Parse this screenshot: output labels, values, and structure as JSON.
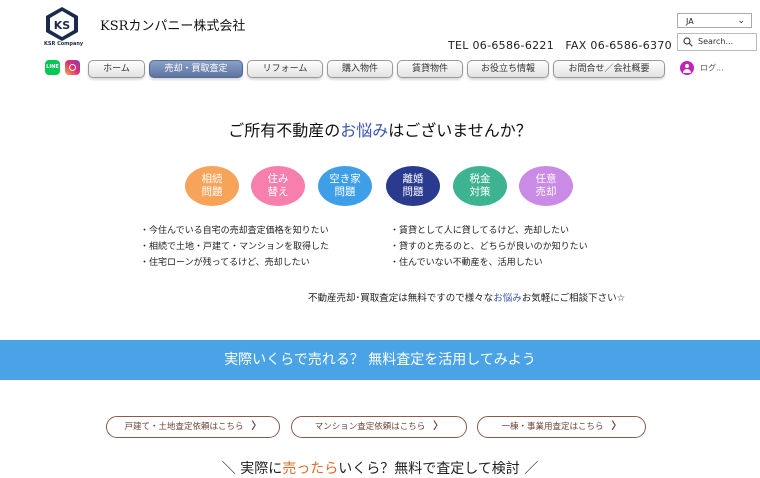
{
  "header": {
    "logo_text": "KSR Company",
    "company_name": "KSRカンパニー株式会社",
    "language": "JA",
    "phone_line": "TEL 06-6586-6221　FAX 06-6586-6370",
    "search_placeholder": "Search...",
    "login_label": "ログ..."
  },
  "nav": {
    "items": [
      {
        "label": "ホーム"
      },
      {
        "label": "売却・買取査定"
      },
      {
        "label": "リフォーム"
      },
      {
        "label": "購入物件"
      },
      {
        "label": "賃貸物件"
      },
      {
        "label": "お役立ち情報"
      },
      {
        "label": "お問合せ／会社概要"
      }
    ],
    "active": "売却・買取査定"
  },
  "headline": {
    "before": "ご所有不動産の",
    "highlight": "お悩み",
    "after": "はございませんか？"
  },
  "categories": [
    {
      "line1": "相続",
      "line2": "問題",
      "color": "#f7a35a"
    },
    {
      "line1": "住み",
      "line2": "替え",
      "color": "#f77fae"
    },
    {
      "line1": "空き家",
      "line2": "問題",
      "color": "#3f9ee8"
    },
    {
      "line1": "離婚",
      "line2": "問題",
      "color": "#2a3b8f"
    },
    {
      "line1": "税金",
      "line2": "対策",
      "color": "#3eb391"
    },
    {
      "line1": "任意",
      "line2": "売却",
      "color": "#c98be6"
    }
  ],
  "concerns_left": [
    "今住んでいる自宅の売却査定価格を知りたい",
    "相続で土地・戸建て・マンションを取得した",
    "住宅ローンが残ってるけど、売却したい"
  ],
  "concerns_right": [
    "賃貸として人に貸してるけど、売却したい",
    "貸すのと売るのと、どちらが良いのか知りたい",
    "住んでいない不動産を、活用したい"
  ],
  "note": {
    "before": "不動産売却･買取査定は無料ですので様々な",
    "highlight": "お悩み",
    "after": "お気軽にご相談下さい☆"
  },
  "banner_text": "実際いくらで売れる？ 無料査定を活用してみよう",
  "cta_buttons": [
    {
      "label": "戸建て・土地査定依頼はこちら"
    },
    {
      "label": "マンション査定依頼はこちら"
    },
    {
      "label": "一棟・事業用査定はこちら"
    }
  ],
  "bottom_title": {
    "before": "＼ 実際に",
    "highlight": "売ったら",
    "after": "いくら？無料で査定して検討 ／"
  },
  "icons": {
    "social": [
      "line-icon",
      "instagram-icon"
    ],
    "search": "search-icon",
    "language_dropdown": "chevron-down-icon",
    "login": "avatar-icon"
  }
}
